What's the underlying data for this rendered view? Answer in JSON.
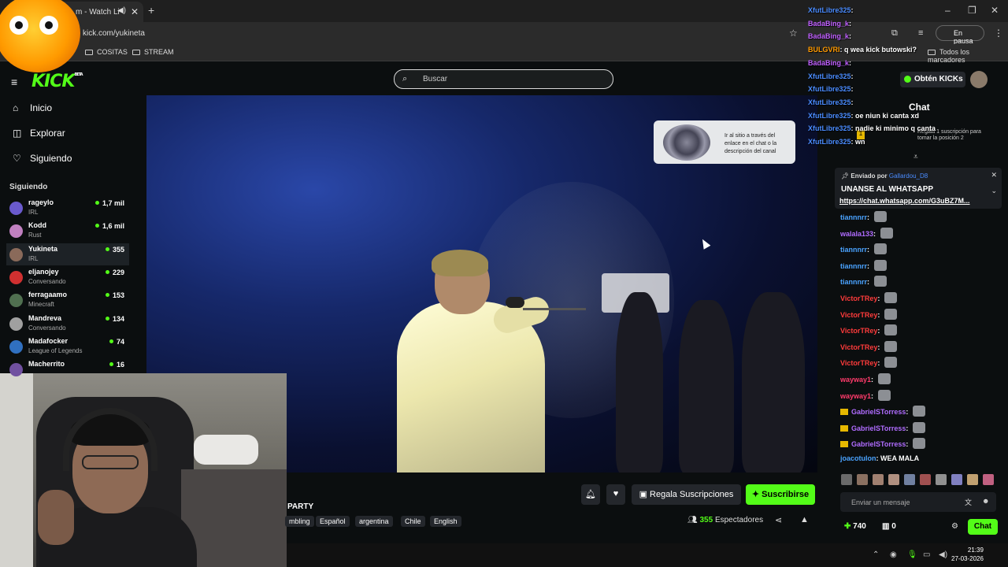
{
  "browser": {
    "tab_title": "m - Watch Li",
    "url": "kick.com/yukineta",
    "bookmarks": [
      "COSITAS",
      "STREAM"
    ],
    "all_bookmarks": "Todos los marcadores",
    "profile_status": "En pausa"
  },
  "header": {
    "logo": "KICK",
    "logo_badge": "BETA",
    "search_placeholder": "Buscar",
    "kicks_button": "Obtén KICKs"
  },
  "sidebar": {
    "nav": [
      {
        "label": "Inicio",
        "icon": "home-icon"
      },
      {
        "label": "Explorar",
        "icon": "compass-icon"
      },
      {
        "label": "Siguiendo",
        "icon": "heart-icon"
      }
    ],
    "following_title": "Siguiendo",
    "channels": [
      {
        "name": "rageylo",
        "category": "IRL",
        "viewers": "1,7 mil",
        "color": "#6a5acd"
      },
      {
        "name": "Kodd",
        "category": "Rust",
        "viewers": "1,6 mil",
        "color": "#c080c0"
      },
      {
        "name": "Yukineta",
        "category": "IRL",
        "viewers": "355",
        "color": "#8a6a5a"
      },
      {
        "name": "eljanojey",
        "category": "Conversando",
        "viewers": "229",
        "color": "#d03030"
      },
      {
        "name": "ferragaamo",
        "category": "Minecraft",
        "viewers": "153",
        "color": "#507050"
      },
      {
        "name": "Mandreva",
        "category": "Conversando",
        "viewers": "134",
        "color": "#a0a0a0"
      },
      {
        "name": "Madafocker",
        "category": "League of Legends",
        "viewers": "74",
        "color": "#3070c0"
      },
      {
        "name": "Macherrito",
        "category": "",
        "viewers": "16",
        "color": "#7050a0"
      }
    ]
  },
  "video": {
    "overlay_card_text": "Ir al sitio a través del enlace en el chat o la descripción del canal"
  },
  "stream": {
    "title_fragment": "PARTY",
    "tags": [
      "mbling",
      "Español",
      "argentina",
      "Chile",
      "English"
    ],
    "gift_button": "Regala Suscripciones",
    "subscribe_button": "Suscribirse",
    "viewers_count": "355",
    "viewers_label": "Espectadores"
  },
  "chat": {
    "title": "Chat",
    "leaderboard_hint": "Regala 1 suscripción para tomar la posición 2",
    "leaderboard_rank": "1",
    "pinned": {
      "sent_by": "Enviado por",
      "user": "Gallardou_D8",
      "message": "UNANSE AL WHATSAPP",
      "link": "https://chat.whatsapp.com/G3uBZ7M..."
    },
    "messages": [
      {
        "user": "tiannnrr",
        "color": "#4aa3ff",
        "text": "",
        "emote": true,
        "crown": false
      },
      {
        "user": "walala133",
        "color": "#b06cff",
        "text": "",
        "emote": true,
        "crown": false
      },
      {
        "user": "tiannnrr",
        "color": "#4aa3ff",
        "text": "",
        "emote": true,
        "crown": false
      },
      {
        "user": "tiannnrr",
        "color": "#4aa3ff",
        "text": "",
        "emote": true,
        "crown": false
      },
      {
        "user": "tiannnrr",
        "color": "#4aa3ff",
        "text": "",
        "emote": true,
        "crown": false
      },
      {
        "user": "VictorTRey",
        "color": "#ff3b3b",
        "text": "",
        "emote": true,
        "crown": false
      },
      {
        "user": "VictorTRey",
        "color": "#ff3b3b",
        "text": "",
        "emote": true,
        "crown": false
      },
      {
        "user": "VictorTRey",
        "color": "#ff3b3b",
        "text": "",
        "emote": true,
        "crown": false
      },
      {
        "user": "VictorTRey",
        "color": "#ff3b3b",
        "text": "",
        "emote": true,
        "crown": false
      },
      {
        "user": "VictorTRey",
        "color": "#ff3b3b",
        "text": "",
        "emote": true,
        "crown": false
      },
      {
        "user": "wayway1",
        "color": "#ff3b6b",
        "text": "",
        "emote": true,
        "crown": false
      },
      {
        "user": "wayway1",
        "color": "#ff3b6b",
        "text": "",
        "emote": true,
        "crown": false
      },
      {
        "user": "GabrielSTorress",
        "color": "#b06cff",
        "text": "",
        "emote": true,
        "crown": true
      },
      {
        "user": "GabrielSTorress",
        "color": "#b06cff",
        "text": "",
        "emote": true,
        "crown": true
      },
      {
        "user": "GabrielSTorress",
        "color": "#b06cff",
        "text": "",
        "emote": true,
        "crown": true
      },
      {
        "user": "joacotulon",
        "color": "#4aa3ff",
        "text": "WEA MALA",
        "emote": false,
        "crown": false
      }
    ],
    "overlay_messages": [
      {
        "user": "XfutLibre325",
        "color": "#4a8cff",
        "text": ""
      },
      {
        "user": "BadaBing_k",
        "color": "#c060ff",
        "text": ""
      },
      {
        "user": "BadaBing_k",
        "color": "#c060ff",
        "text": ""
      },
      {
        "user": "BULGVRI",
        "color": "#ff9a00",
        "text": "q wea kick butowski?"
      },
      {
        "user": "BadaBing_k",
        "color": "#c060ff",
        "text": ""
      },
      {
        "user": "XfutLibre325",
        "color": "#4a8cff",
        "text": ""
      },
      {
        "user": "XfutLibre325",
        "color": "#4a8cff",
        "text": ""
      },
      {
        "user": "XfutLibre325",
        "color": "#4a8cff",
        "text": ""
      },
      {
        "user": "XfutLibre325",
        "color": "#4a8cff",
        "text": "oe niun ki canta xd"
      },
      {
        "user": "XfutLibre325",
        "color": "#4a8cff",
        "text": "nadie ki minimo q canta"
      },
      {
        "user": "XfutLibre325",
        "color": "#4a8cff",
        "text": "wn"
      }
    ],
    "input_placeholder": "Enviar un mensaje",
    "kicks_balance": "740",
    "gifts_count": "0",
    "send_button": "Chat"
  },
  "taskbar": {
    "time": "21:39",
    "date": "27-03-2026"
  },
  "colors": {
    "accent": "#53fc18",
    "background": "#0b0e0f"
  }
}
